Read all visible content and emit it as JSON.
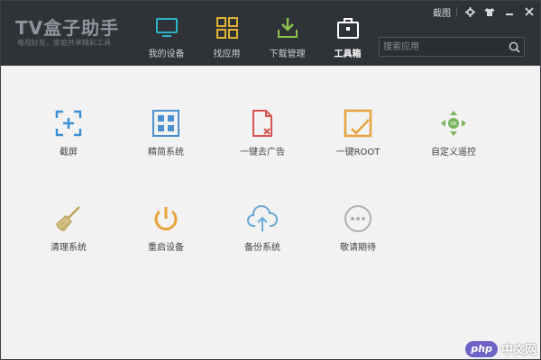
{
  "app": {
    "logo": "TV盒子助手",
    "slogan": "电视好友，家庭共享精彩工具",
    "window_controls": {
      "screenshot_label": "截图",
      "settings_icon": "gear-icon",
      "skin_icon": "shirt-icon",
      "minimize_icon": "minimize-icon",
      "close_icon": "close-icon"
    }
  },
  "nav": {
    "tabs": [
      {
        "label": "我的设备",
        "icon": "monitor-icon",
        "color": "#2bb3c6",
        "active": false
      },
      {
        "label": "找应用",
        "icon": "app-grid-icon",
        "color": "#e1b533",
        "active": false
      },
      {
        "label": "下载管理",
        "icon": "download-icon",
        "color": "#8bc34a",
        "active": false
      },
      {
        "label": "工具箱",
        "icon": "toolbox-icon",
        "color": "#ffffff",
        "active": true
      }
    ]
  },
  "search": {
    "placeholder": "搜索应用",
    "icon": "search-icon"
  },
  "tools": [
    {
      "label": "截屏",
      "icon": "screenshot-icon",
      "color": "#3d8fd1"
    },
    {
      "label": "精简系统",
      "icon": "grid-icon",
      "color": "#4a8fcf"
    },
    {
      "label": "一键去广告",
      "icon": "remove-ad-icon",
      "color": "#d9534f"
    },
    {
      "label": "一键ROOT",
      "icon": "root-check-icon",
      "color": "#e6a43a"
    },
    {
      "label": "自定义遥控",
      "icon": "remote-icon",
      "color": "#7ab55c"
    },
    {
      "label": "清理系统",
      "icon": "broom-icon",
      "color": "#b9a35a"
    },
    {
      "label": "重启设备",
      "icon": "power-icon",
      "color": "#e6a43a"
    },
    {
      "label": "备份系统",
      "icon": "cloud-upload-icon",
      "color": "#6aaad6"
    },
    {
      "label": "敬请期待",
      "icon": "more-icon",
      "color": "#aab0b6"
    }
  ],
  "watermark": {
    "badge": "php",
    "text": "中文网"
  }
}
